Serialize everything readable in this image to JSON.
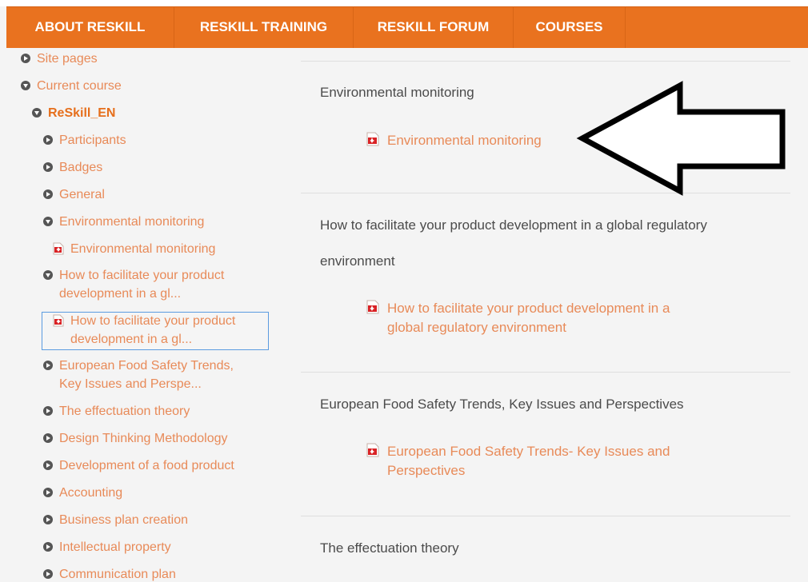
{
  "navbar": {
    "items": [
      {
        "label": "ABOUT RESKILL"
      },
      {
        "label": "RESKILL TRAINING"
      },
      {
        "label": "RESKILL FORUM"
      },
      {
        "label": "COURSES"
      }
    ]
  },
  "sidebar": {
    "items": [
      {
        "label": "Site pages"
      },
      {
        "label": "Current course"
      },
      {
        "label": "ReSkill_EN"
      },
      {
        "label": "Participants"
      },
      {
        "label": "Badges"
      },
      {
        "label": "General"
      },
      {
        "label": "Environmental monitoring"
      },
      {
        "label": "Environmental monitoring"
      },
      {
        "label": "How to facilitate your product",
        "label2": "development in a gl..."
      },
      {
        "label": "How to facilitate your product",
        "label2": "development in a gl..."
      },
      {
        "label": "European Food Safety Trends,",
        "label2": "Key Issues and Perspe..."
      },
      {
        "label": "The effectuation theory"
      },
      {
        "label": "Design Thinking Methodology"
      },
      {
        "label": "Development of a food product"
      },
      {
        "label": "Accounting"
      },
      {
        "label": "Business plan creation"
      },
      {
        "label": "Intellectual property"
      },
      {
        "label": "Communication plan"
      }
    ]
  },
  "content": {
    "sections": [
      {
        "title": "Environmental monitoring",
        "resource": "Environmental monitoring"
      },
      {
        "title": "How to facilitate your product development in a global regulatory",
        "title2": "environment",
        "resource": "How to facilitate your product development in a",
        "resource2": "global regulatory environment"
      },
      {
        "title": "European Food Safety Trends, Key Issues and Perspectives",
        "resource": "European Food Safety Trends- Key Issues and",
        "resource2": "Perspectives"
      },
      {
        "title": "The effectuation theory"
      }
    ]
  },
  "colors": {
    "accent": "#e9721f",
    "link": "#e88a58",
    "text": "#4b4b4b"
  }
}
